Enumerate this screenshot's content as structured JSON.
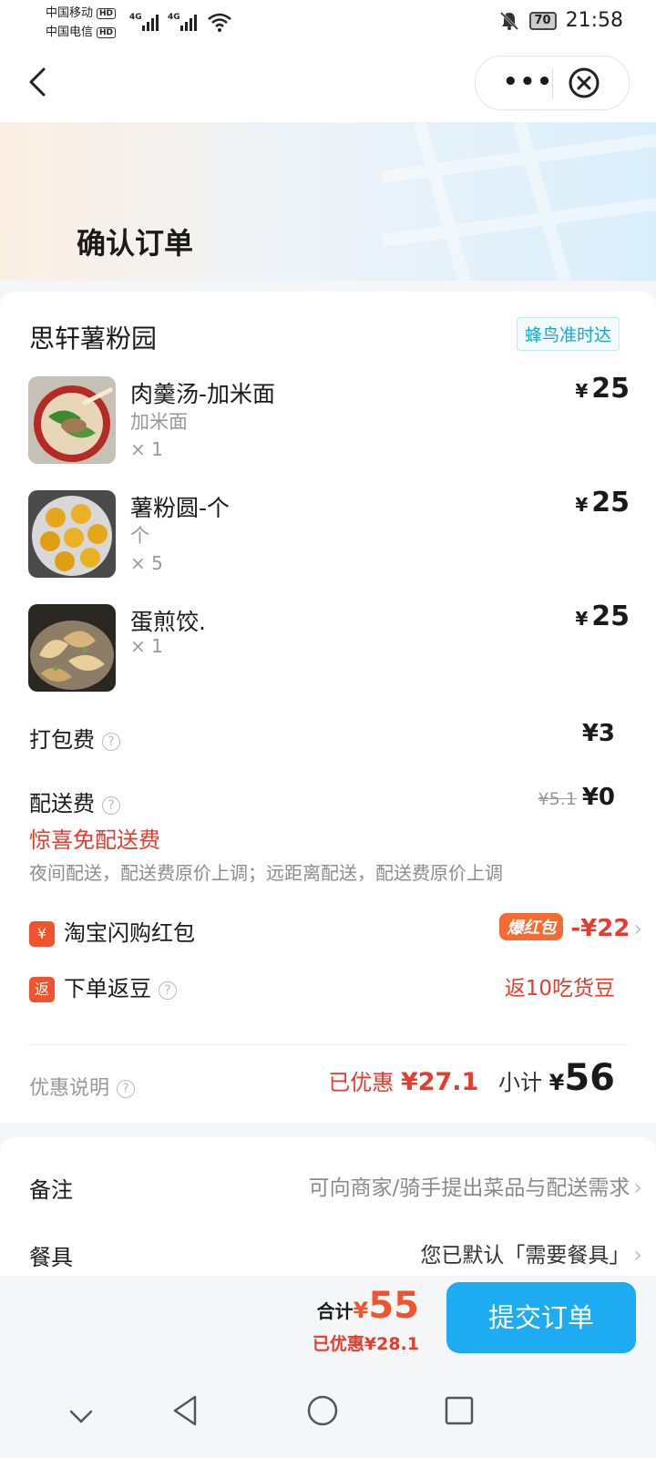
{
  "status_bar": {
    "carrier1": "中国移动",
    "carrier2": "中国电信",
    "hd": "HD",
    "net": "4G",
    "battery": "70",
    "time": "21:58"
  },
  "header": {
    "title": "确认订单"
  },
  "shop": {
    "name": "思轩薯粉园",
    "delivery_tag": "蜂鸟准时达",
    "currency": "¥",
    "items": [
      {
        "name": "肉羹汤-加米面",
        "spec": "加米面",
        "qty": "× 1",
        "price": "25"
      },
      {
        "name": "薯粉圆-个",
        "spec": "个",
        "qty": "× 5",
        "price": "25"
      },
      {
        "name": "蛋煎饺.",
        "spec": "",
        "qty": "× 1",
        "price": "25"
      }
    ]
  },
  "fees": {
    "packing_label": "打包费",
    "packing_value": "¥3",
    "delivery_label": "配送费",
    "delivery_original": "¥5.1",
    "delivery_value": "¥0",
    "free_delivery": "惊喜免配送费",
    "delivery_note": "夜间配送，配送费原价上调；远距离配送，配送费原价上调"
  },
  "promos": {
    "redpacket_badge": "¥",
    "redpacket_label": "淘宝闪购红包",
    "redpacket_tag": "爆红包",
    "redpacket_value": "-¥22",
    "beans_badge": "返",
    "beans_label": "下单返豆",
    "beans_value": "返10吃货豆"
  },
  "summary": {
    "explain_label": "优惠说明",
    "discount_label": "已优惠",
    "discount_value": "¥27.1",
    "subtotal_label": "小计",
    "subtotal_currency": "¥",
    "subtotal_value": "56"
  },
  "remarks": {
    "note_label": "备注",
    "note_placeholder": "可向商家/骑手提出菜品与配送需求",
    "tableware_label": "餐具",
    "tableware_value": "您已默认「需要餐具」"
  },
  "checkout": {
    "total_label": "合计",
    "total_currency": "¥",
    "total_value": "55",
    "discount_text": "已优惠¥28.1",
    "submit_label": "提交订单"
  },
  "colors": {
    "accent": "#1dabf1",
    "discount_red": "#e63b2e",
    "price_orange": "#f0532d"
  }
}
